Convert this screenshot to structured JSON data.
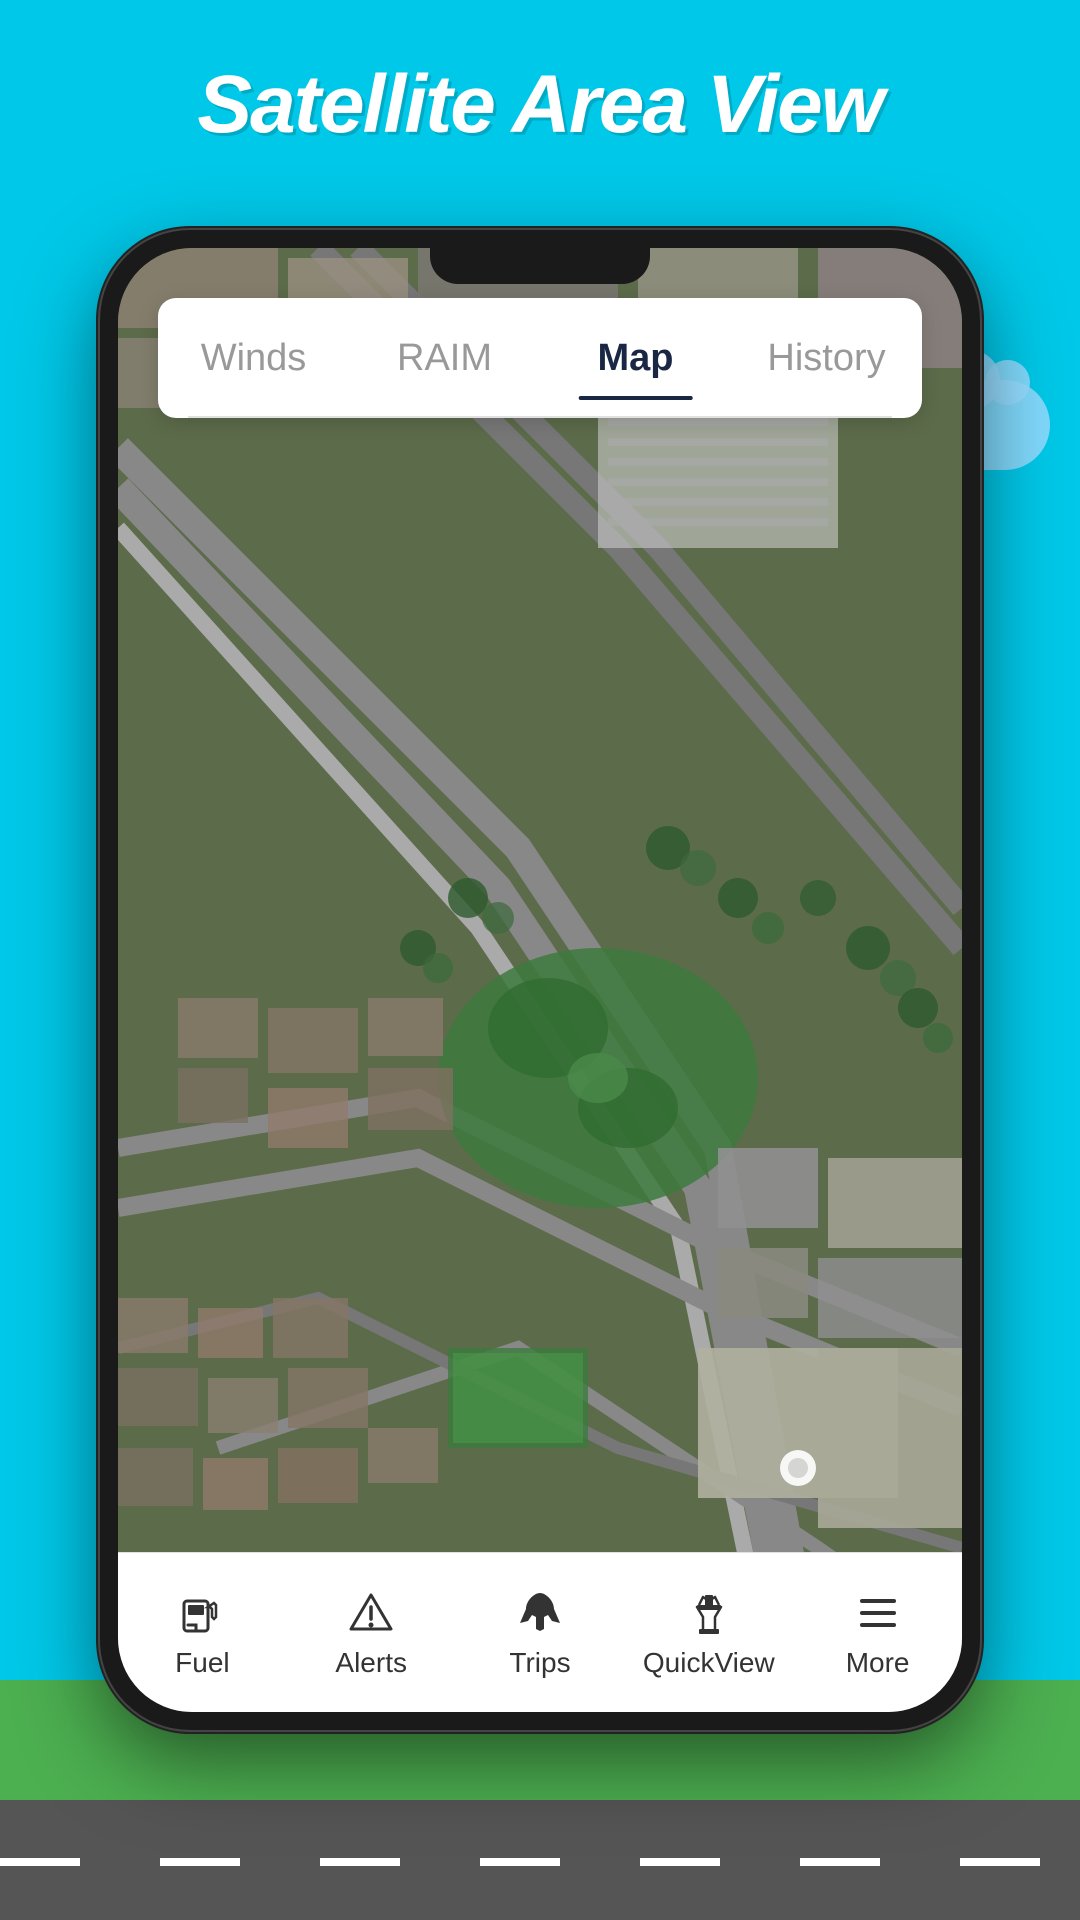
{
  "page": {
    "title": "Satellite Area View",
    "background_color": "#00c8e8"
  },
  "tabs": {
    "items": [
      {
        "id": "winds",
        "label": "Winds",
        "active": false
      },
      {
        "id": "raim",
        "label": "RAIM",
        "active": false
      },
      {
        "id": "map",
        "label": "Map",
        "active": true
      },
      {
        "id": "history",
        "label": "History",
        "active": false
      }
    ]
  },
  "bottom_nav": {
    "items": [
      {
        "id": "fuel",
        "label": "Fuel",
        "icon": "fuel-icon"
      },
      {
        "id": "alerts",
        "label": "Alerts",
        "icon": "alerts-icon"
      },
      {
        "id": "trips",
        "label": "Trips",
        "icon": "trips-icon"
      },
      {
        "id": "quickview",
        "label": "QuickView",
        "icon": "quickview-icon"
      },
      {
        "id": "more",
        "label": "More",
        "icon": "more-icon"
      }
    ]
  }
}
